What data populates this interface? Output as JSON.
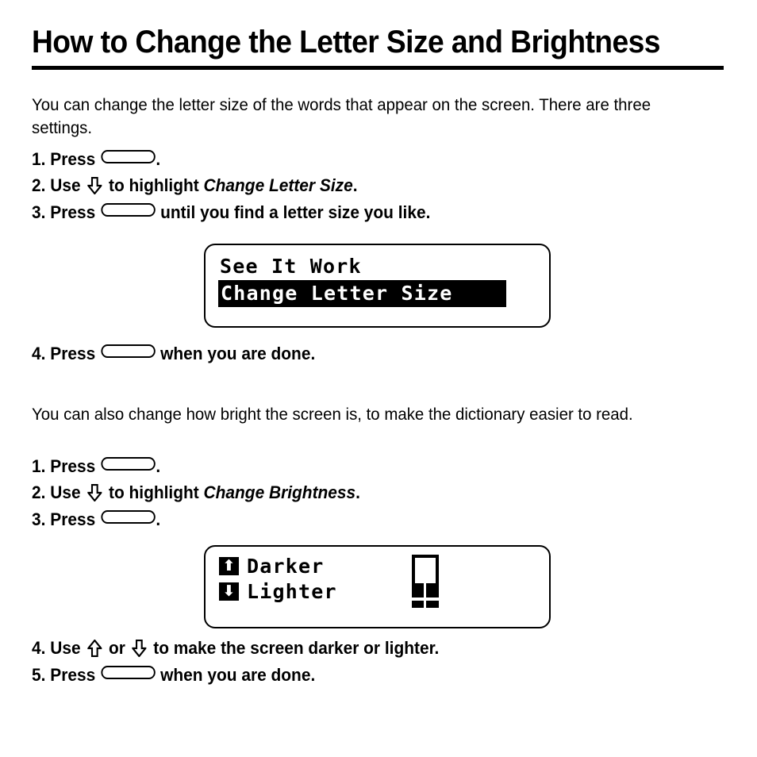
{
  "page": {
    "title": "How to Change the Letter Size and Brightness"
  },
  "section_one": {
    "intro": "You can change the letter size of the words that appear on the screen. There are three settings.",
    "steps": [
      {
        "number": "1.",
        "before": "Press",
        "after": "."
      },
      {
        "number": "2.",
        "before": "Use",
        "middle": "to highlight",
        "emphasis": "Change Letter Size",
        "after": "."
      },
      {
        "number": "3.",
        "before": "Press",
        "after": "until you find a letter size you like."
      },
      {
        "number": "4.",
        "before": "Press",
        "after": "when you are done."
      }
    ],
    "screen": {
      "line1": "See It Work",
      "line2": "Change Letter Size",
      "line2_style": "inverse-highlight"
    }
  },
  "section_two": {
    "intro": "You can also change how bright the screen is, to make the dictionary easier to read.",
    "steps": [
      {
        "number": "1.",
        "before": "Press",
        "after": "."
      },
      {
        "number": "2.",
        "before": "Use",
        "middle": "to highlight",
        "emphasis": "Change Brightness",
        "after": "."
      },
      {
        "number": "3.",
        "before": "Press",
        "after": "."
      },
      {
        "number": "4.",
        "before": "Use",
        "conjunction": "or",
        "after": "to make the screen darker or lighter."
      },
      {
        "number": "5.",
        "before": "Press",
        "after": "when you are done."
      }
    ],
    "screen": {
      "row1_label": "Darker",
      "row1_icon": "up-arrow",
      "row2_label": "Lighter",
      "row2_icon": "down-arrow",
      "gauge": {
        "name": "brightness-gauge",
        "fill_level": "50%"
      }
    }
  },
  "glyphs": {
    "down_arrow": "⇩",
    "up_arrow": "⇧",
    "badge_up": "⬆",
    "badge_down": "⬇",
    "blank_key": ""
  },
  "colors": {
    "ink": "#000000",
    "paper": "#ffffff"
  }
}
